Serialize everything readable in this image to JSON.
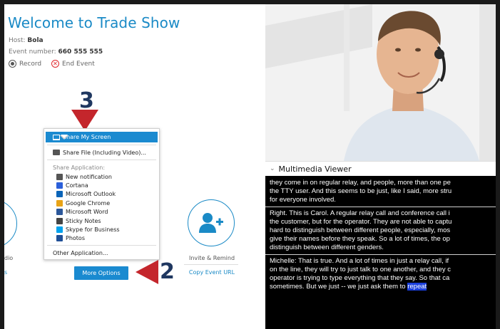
{
  "event": {
    "title": "Welcome to Trade Show",
    "host_label": "Host:",
    "host_name": "Bola",
    "event_number_label": "Event number:",
    "event_number": "660 555 555",
    "record_label": "Record",
    "end_event_label": "End Event"
  },
  "annotations": {
    "step3": "3",
    "step2": "2"
  },
  "share_menu": {
    "share_screen": "Share My Screen",
    "share_file": "Share File (Including Video)...",
    "share_application_header": "Share Application:",
    "applications": [
      {
        "label": "New notification",
        "icon": "notification-app-icon",
        "color": "#555555"
      },
      {
        "label": "Cortana",
        "icon": "cortana-app-icon",
        "color": "#2b5fd9"
      },
      {
        "label": "Microsoft Outlook",
        "icon": "outlook-app-icon",
        "color": "#0a64b8"
      },
      {
        "label": "Google Chrome",
        "icon": "chrome-app-icon",
        "color": "#e8a317"
      },
      {
        "label": "Microsoft Word",
        "icon": "word-app-icon",
        "color": "#2b579a"
      },
      {
        "label": "Sticky Notes",
        "icon": "sticky-notes-app-icon",
        "color": "#444444"
      },
      {
        "label": "Skype for Business",
        "icon": "skype-app-icon",
        "color": "#00a2ed"
      },
      {
        "label": "Photos",
        "icon": "photos-app-icon",
        "color": "#1f4f96"
      }
    ],
    "other_application": "Other Application..."
  },
  "actions": {
    "more_options": "More Options",
    "partial_label": "dio",
    "partial_link": "s",
    "invite_remind": "Invite & Remind",
    "copy_event_url": "Copy Event URL"
  },
  "multimedia": {
    "title": "Multimedia Viewer",
    "paragraphs": [
      [
        "they come in on regular relay, and people, more than one pe",
        "the TTY user. And this seems to be just, like I said, more stru",
        "for everyone involved."
      ],
      [
        "Right. This is Carol. A regular relay call and conference call i",
        "the customer, but for the operator. They are not able to captu",
        "hard to distinguish between different people, especially, mos",
        "give their names before they speak. So a lot of times, the op",
        "distinguish between different genders."
      ],
      [
        "Michelle: That is true. And a lot of times in just a relay call, if",
        "on the line, they will try to just talk to one another, and they c",
        "operator is trying to type everything that they say. So that ca",
        "sometimes. But we just -- we just ask them to "
      ]
    ],
    "highlighted_word": "repeat"
  },
  "colors": {
    "accent": "#1a8ad0",
    "annotation_red": "#c4262c",
    "annotation_navy": "#1f3760",
    "highlight": "#1a3fdc"
  }
}
